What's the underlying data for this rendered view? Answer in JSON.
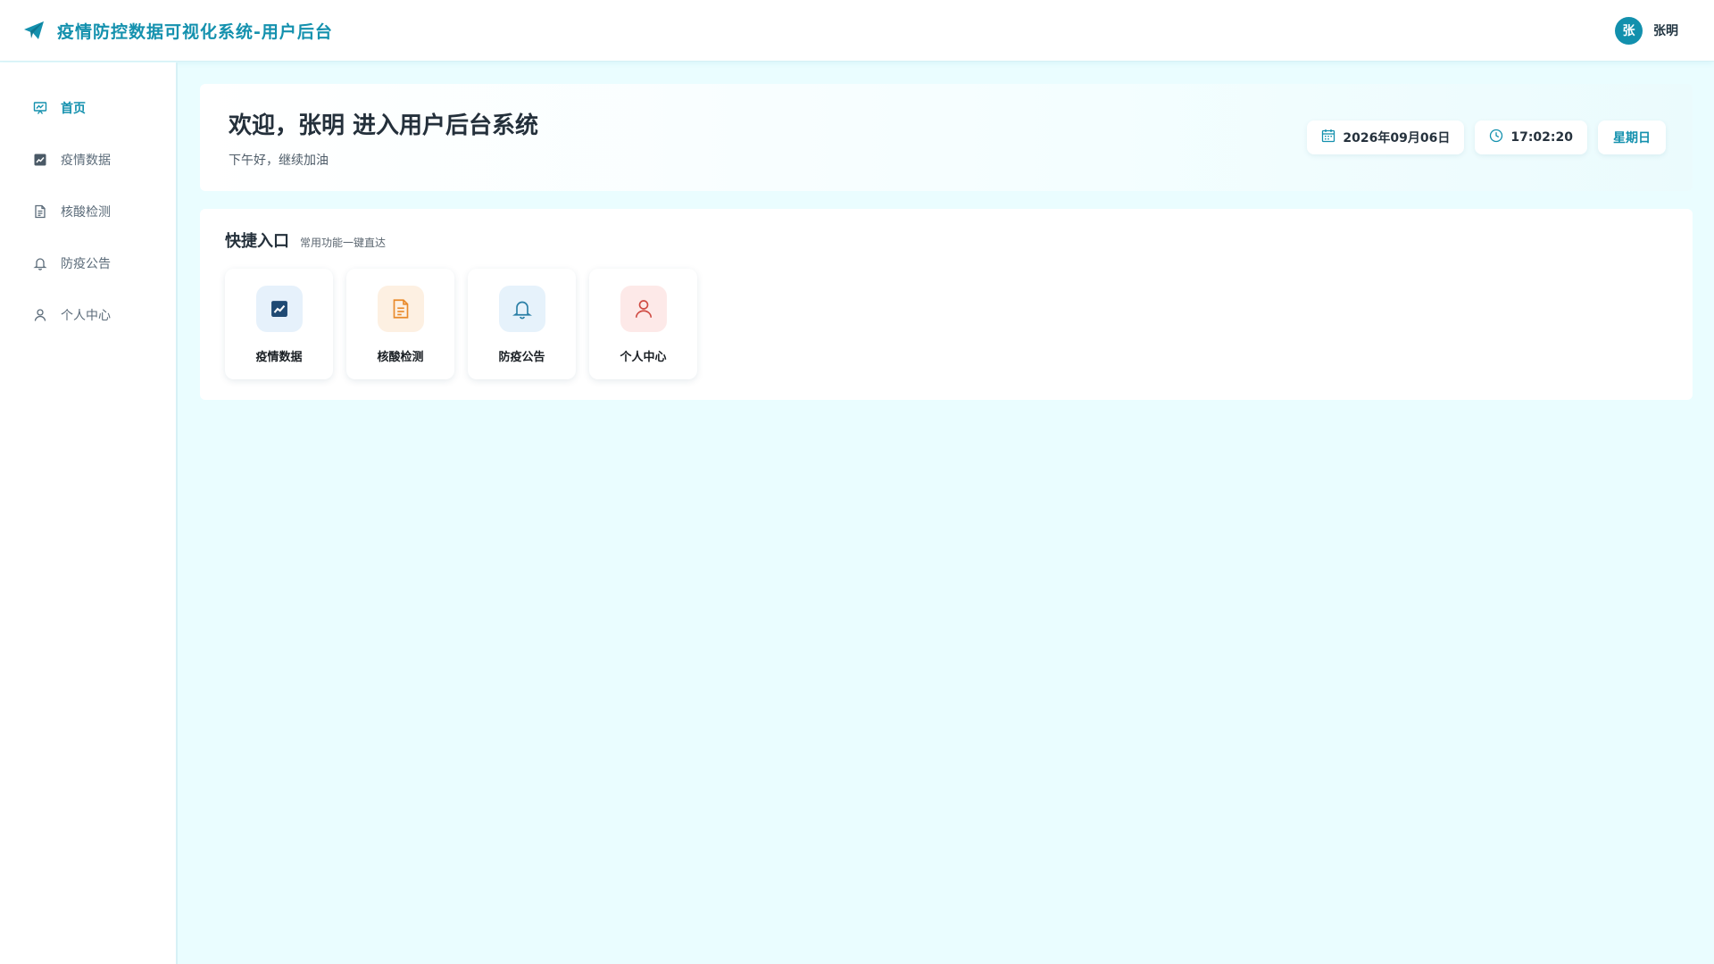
{
  "header": {
    "title": "疫情防控数据可视化系统-用户后台",
    "user": {
      "avatar_text": "张",
      "name": "张明"
    }
  },
  "sidebar": {
    "items": [
      {
        "label": "首页",
        "icon": "presentation-chart-icon",
        "active": true
      },
      {
        "label": "疫情数据",
        "icon": "line-chart-icon",
        "active": false
      },
      {
        "label": "核酸检测",
        "icon": "document-icon",
        "active": false
      },
      {
        "label": "防疫公告",
        "icon": "bell-icon",
        "active": false
      },
      {
        "label": "个人中心",
        "icon": "user-icon",
        "active": false
      }
    ]
  },
  "welcome": {
    "title": "欢迎，张明 进入用户后台系统",
    "subtitle": "下午好，继续加油",
    "date": "2026年09月06日",
    "time": "17:02:20",
    "weekday": "星期日"
  },
  "quick_access": {
    "title": "快捷入口",
    "subtitle": "常用功能一键直达",
    "items": [
      {
        "label": "疫情数据",
        "icon": "line-chart-icon",
        "bg": "#e6f1fb",
        "color": "#1f4a73"
      },
      {
        "label": "核酸检测",
        "icon": "document-icon",
        "bg": "#fdf0e2",
        "color": "#e98a2b"
      },
      {
        "label": "防疫公告",
        "icon": "bell-icon",
        "bg": "#e6f2fb",
        "color": "#2a7fa6"
      },
      {
        "label": "个人中心",
        "icon": "user-icon",
        "bg": "#fde9e8",
        "color": "#cf4a42"
      }
    ]
  },
  "colors": {
    "accent": "#1491ae",
    "background": "#eafdff"
  }
}
